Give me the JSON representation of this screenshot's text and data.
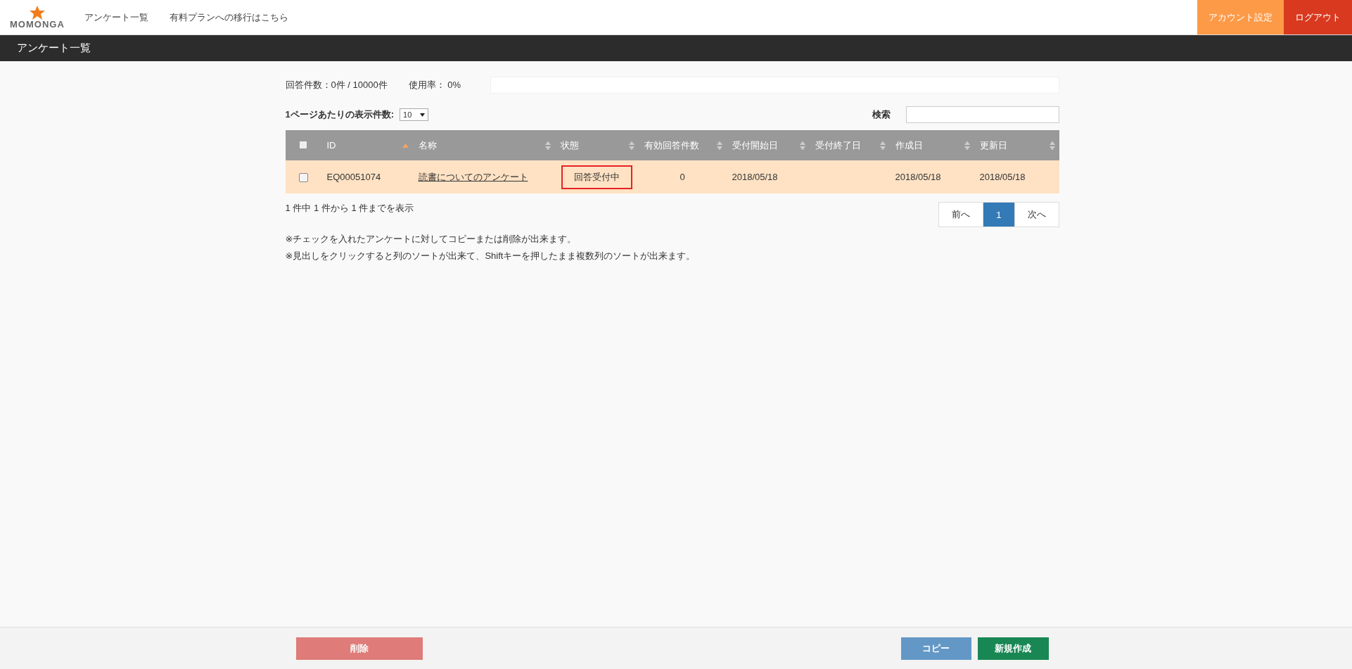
{
  "header": {
    "logo": "MOMONGA",
    "nav": [
      {
        "label": "アンケート一覧"
      },
      {
        "label": "有料プランへの移行はこちら"
      }
    ],
    "actions": [
      {
        "label": "アカウント設定",
        "kind": "account"
      },
      {
        "label": "ログアウト",
        "kind": "logout"
      }
    ]
  },
  "page_title": "アンケート一覧",
  "usage": {
    "responses_label": "回答件数：0件 / 10000件",
    "rate_label": "使用率： 0%",
    "level": 0
  },
  "page_size": {
    "label": "1ページあたりの表示件数:",
    "value": "10"
  },
  "search": {
    "label": "検索"
  },
  "table": {
    "columns": [
      {
        "kind": "checkbox",
        "checked": false
      },
      {
        "label": "ID",
        "sorted": true
      },
      {
        "label": "名称",
        "sorted": false
      },
      {
        "label": "状態",
        "sorted": false
      },
      {
        "label": "有効回答件数",
        "sorted": false
      },
      {
        "label": "受付開始日",
        "sorted": false
      },
      {
        "label": "受付終了日",
        "sorted": false
      },
      {
        "label": "作成日",
        "sorted": false
      },
      {
        "label": "更新日",
        "sorted": false
      }
    ],
    "rows": [
      {
        "checked": false,
        "id": "EQ00051074",
        "name": "読書についてのアンケート",
        "status": "回答受付中",
        "status_highlighted": true,
        "valid_responses": "0",
        "start_date": "2018/05/18",
        "created": "2018/05/18",
        "updated": "2018/05/18"
      }
    ]
  },
  "table_info": "1 件中 1 件から 1 件までを表示",
  "pagination": [
    {
      "label": "前へ",
      "selected": false
    },
    {
      "label": "1",
      "selected": true
    },
    {
      "label": "次へ",
      "selected": false
    }
  ],
  "notes": [
    "※チェックを入れたアンケートに対してコピーまたは削除が出来ます。",
    "※見出しをクリックすると列のソートが出来て、Shiftキーを押したまま複数列のソートが出来ます。"
  ],
  "footer": {
    "left": [
      {
        "label": "削除",
        "kind": "delete",
        "disabled": true
      }
    ],
    "right": [
      {
        "label": "コピー",
        "kind": "copy",
        "disabled": true
      },
      {
        "label": "新規作成",
        "kind": "create",
        "disabled": false
      }
    ]
  }
}
